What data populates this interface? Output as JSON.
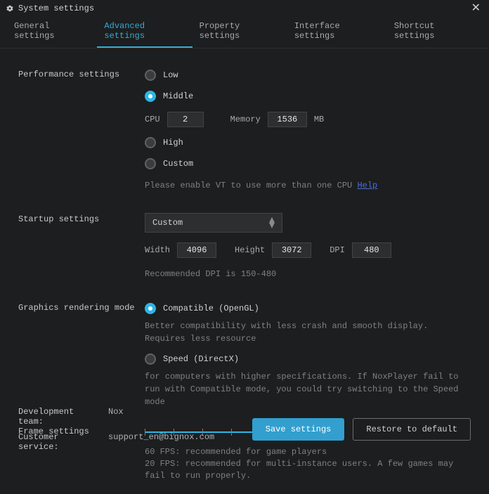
{
  "window": {
    "title": "System settings"
  },
  "tabs": {
    "general": "General settings",
    "advanced": "Advanced settings",
    "property": "Property settings",
    "interface": "Interface settings",
    "shortcut": "Shortcut settings"
  },
  "performance": {
    "label": "Performance settings",
    "low": "Low",
    "middle": "Middle",
    "cpu_label": "CPU",
    "cpu_value": "2",
    "mem_label": "Memory",
    "mem_value": "1536",
    "mem_unit": "MB",
    "high": "High",
    "custom": "Custom",
    "vt_hint": "Please enable VT to use more than one CPU",
    "help": "Help"
  },
  "startup": {
    "label": "Startup settings",
    "selected": "Custom",
    "width_label": "Width",
    "width_value": "4096",
    "height_label": "Height",
    "height_value": "3072",
    "dpi_label": "DPI",
    "dpi_value": "480",
    "dpi_hint": "Recommended DPI is 150-480"
  },
  "graphics": {
    "label": "Graphics rendering mode",
    "compat": "Compatible (OpenGL)",
    "compat_hint": "Better compatibility with less crash and smooth display. Requires less resource",
    "speed": "Speed (DirectX)",
    "speed_hint": "for computers with higher specifications. If NoxPlayer fail to run with Compatible mode, you could try switching to the Speed mode"
  },
  "frame": {
    "label": "Frame settings",
    "value": "60",
    "hint1": "60 FPS: recommended for game players",
    "hint2": "20 FPS: recommended for multi-instance users. A few games may fail to run properly."
  },
  "footer": {
    "dev_k": "Development team:",
    "dev_v": "Nox",
    "cs_k": "Customer service:",
    "cs_v": "support_en@bignox.com",
    "save": "Save settings",
    "restore": "Restore to default"
  }
}
